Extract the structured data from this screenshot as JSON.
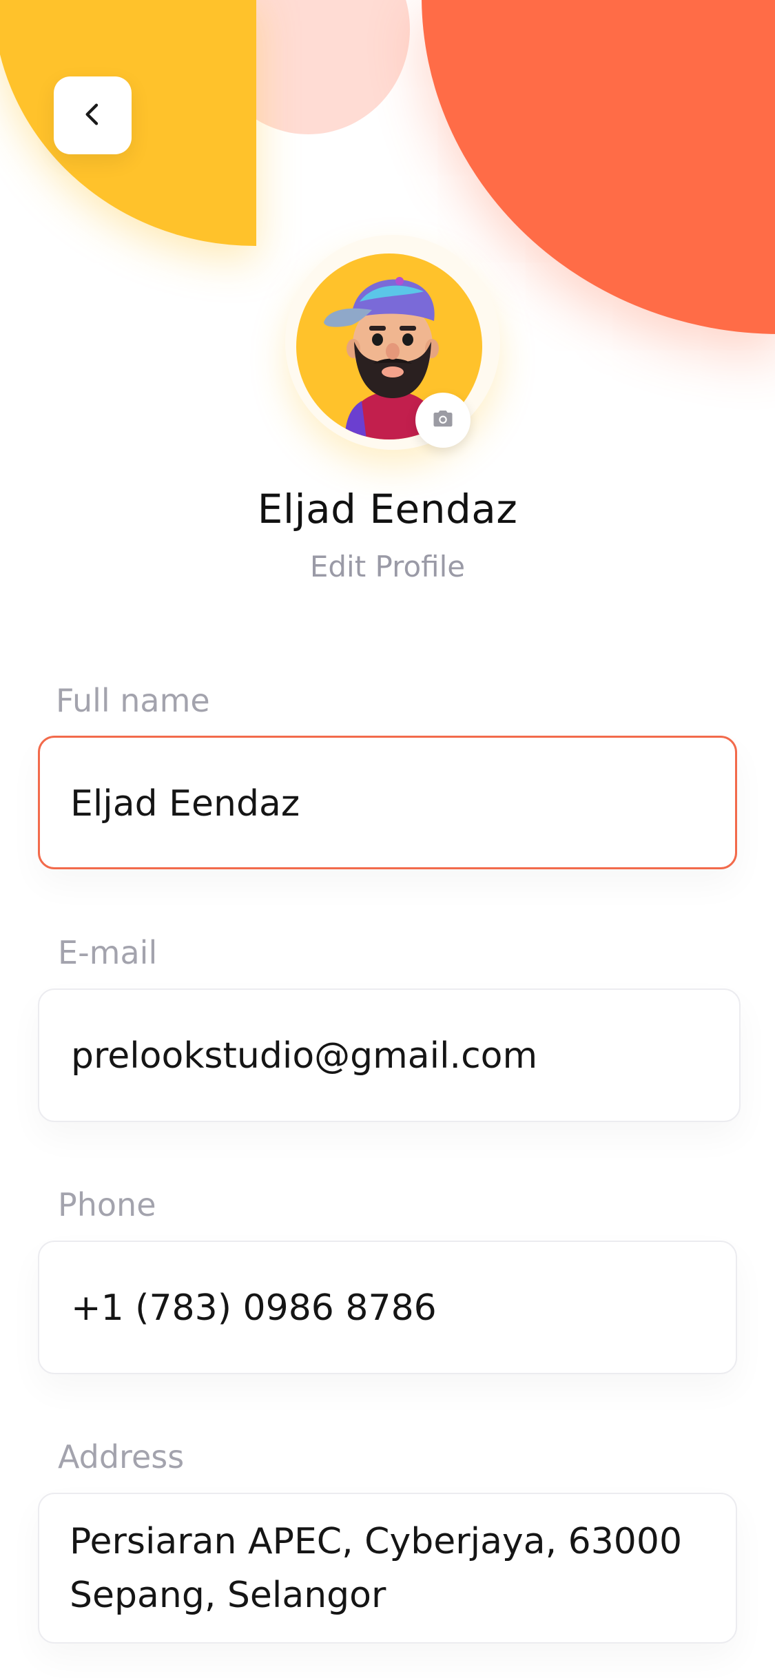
{
  "profile": {
    "name": "Eljad Eendaz",
    "subtitle": "Edit Profile"
  },
  "form": {
    "fields": [
      {
        "label": "Full name",
        "value": "Eljad Eendaz"
      },
      {
        "label": "E-mail",
        "value": "prelookstudio@gmail.com"
      },
      {
        "label": "Phone",
        "value": "+1 (783) 0986 8786"
      },
      {
        "label": "Address",
        "value_line1": "Persiaran APEC, Cyberjaya, 63000",
        "value_line2": "Sepang, Selangor"
      }
    ]
  },
  "icons": {
    "back": "chevron-left-icon",
    "camera": "camera-icon"
  },
  "colors": {
    "yellow": "#ffc22b",
    "orange": "#ff6c47",
    "pink": "#ffd6cc",
    "active_border": "#f26a4b",
    "label": "#a3a3ad"
  }
}
